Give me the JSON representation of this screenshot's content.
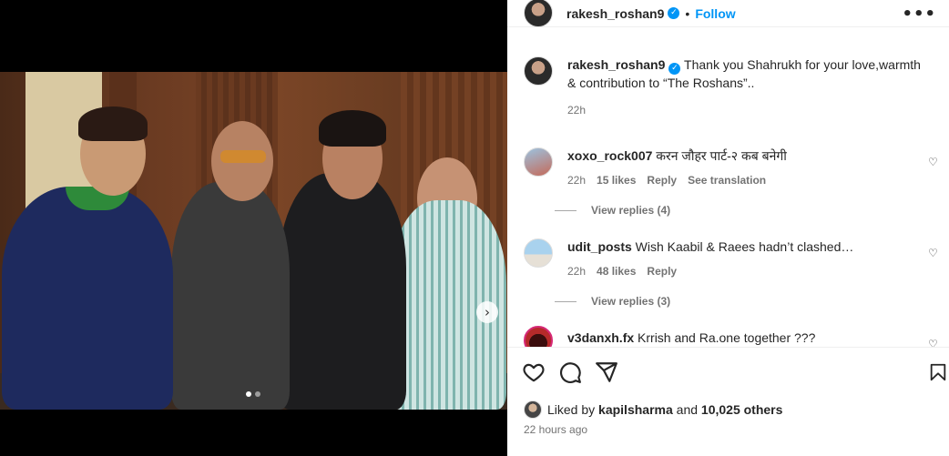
{
  "post": {
    "author": "rakesh_roshan9",
    "follow_label": "Follow",
    "more_label": "•••",
    "caption": "Thank you Shahrukh for your love,warmth & contribution to “The Roshans”..",
    "caption_time": "22h",
    "carousel": {
      "slide": 1,
      "total_slides": 2,
      "next_glyph": "›"
    }
  },
  "comments": [
    {
      "user": "xoxo_rock007",
      "text": "करन जौहर पार्ट-२ कब बनेगी",
      "time": "22h",
      "likes": "15 likes",
      "reply_label": "Reply",
      "translation_label": "See translation",
      "view_replies": "View replies (4)"
    },
    {
      "user": "udit_posts",
      "text": "Wish Kaabil & Raees hadn’t clashed…",
      "time": "22h",
      "likes": "48 likes",
      "reply_label": "Reply",
      "view_replies": "View replies (3)"
    },
    {
      "user": "v3danxh.fx",
      "text": "Krrish and Ra.one together ???"
    }
  ],
  "engagement": {
    "liked_by_prefix": "Liked by",
    "liked_by_user": "kapilsharma",
    "and_label": "and",
    "others": "10,025 others",
    "time_ago": "22 hours ago"
  },
  "icons": {
    "like": "heart-icon",
    "comment": "comment-icon",
    "share": "share-icon",
    "save": "bookmark-icon",
    "verified": "verified-badge-icon"
  },
  "colors": {
    "accent": "#0095f6",
    "text": "#262626",
    "muted": "#737373"
  }
}
